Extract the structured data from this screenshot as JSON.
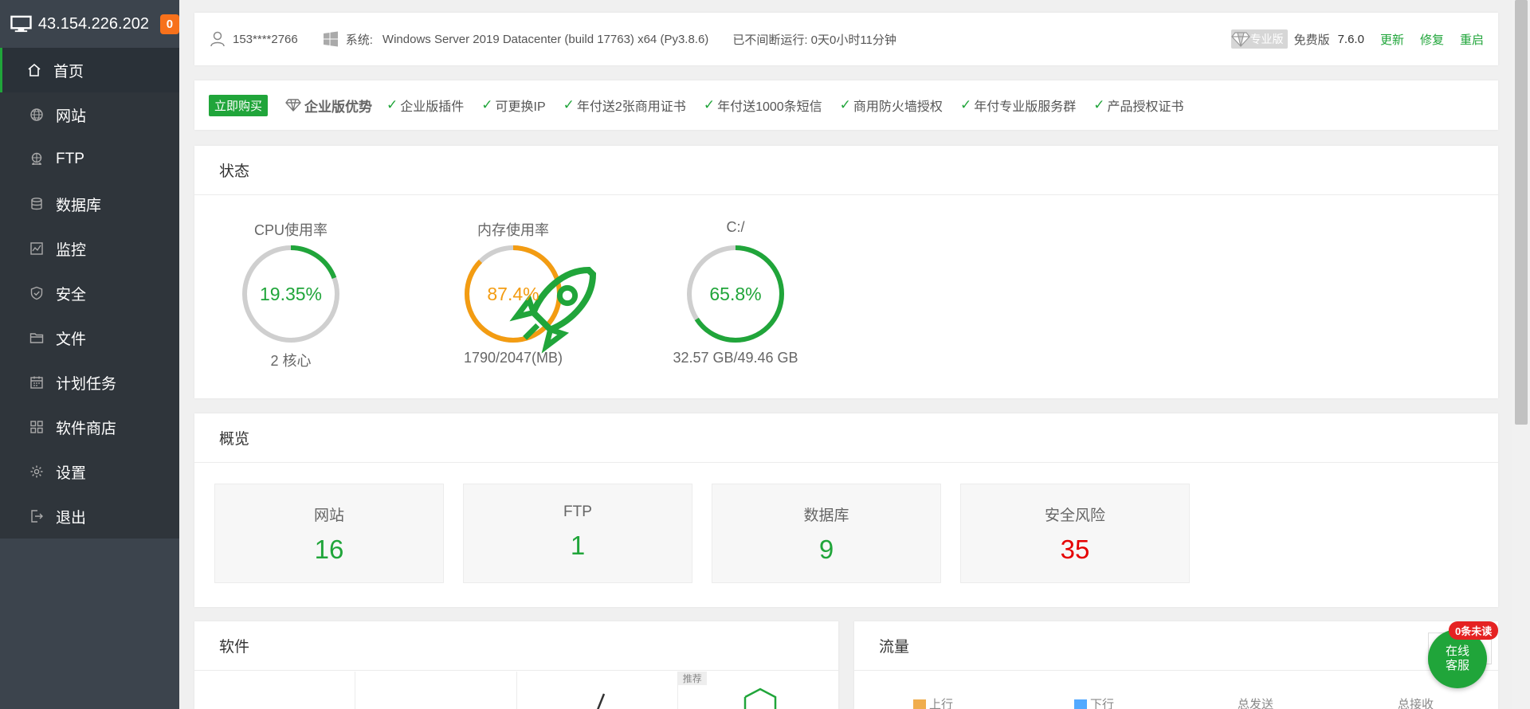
{
  "sidebar": {
    "server_ip": "43.154.226.202",
    "notification_count": "0",
    "items": [
      {
        "label": "首页",
        "icon": "home-icon"
      },
      {
        "label": "网站",
        "icon": "globe-icon"
      },
      {
        "label": "FTP",
        "icon": "ftp-icon"
      },
      {
        "label": "数据库",
        "icon": "database-icon"
      },
      {
        "label": "监控",
        "icon": "monitor-chart-icon"
      },
      {
        "label": "安全",
        "icon": "shield-icon"
      },
      {
        "label": "文件",
        "icon": "folder-icon"
      },
      {
        "label": "计划任务",
        "icon": "calendar-icon"
      },
      {
        "label": "软件商店",
        "icon": "grid-icon"
      },
      {
        "label": "设置",
        "icon": "gear-icon"
      },
      {
        "label": "退出",
        "icon": "logout-icon"
      }
    ],
    "active_index": 0
  },
  "topbar": {
    "user": "153****2766",
    "system_label": "系统:",
    "system_value": "Windows Server 2019 Datacenter (build 17763) x64 (Py3.8.6)",
    "uptime": "已不间断运行: 0天0小时11分钟",
    "pro_tag": "专业版",
    "edition": "免费版",
    "version": "7.6.0",
    "update": "更新",
    "repair": "修复",
    "restart": "重启"
  },
  "promo": {
    "buy_now": "立即购买",
    "title": "企业版优势",
    "features": [
      "企业版插件",
      "可更换IP",
      "年付送2张商用证书",
      "年付送1000条短信",
      "商用防火墙授权",
      "年付专业版服务群",
      "产品授权证书"
    ]
  },
  "status": {
    "title": "状态",
    "gauges": [
      {
        "title": "CPU使用率",
        "value": "19.35%",
        "percent": 19.35,
        "sub": "2 核心",
        "color": "#20a53a"
      },
      {
        "title": "内存使用率",
        "value": "87.4%",
        "percent": 87.4,
        "sub": "1790/2047(MB)",
        "color": "#f39c12"
      },
      {
        "title": "C:/",
        "value": "65.8%",
        "percent": 65.8,
        "sub": "32.57 GB/49.46 GB",
        "color": "#20a53a"
      }
    ]
  },
  "overview": {
    "title": "概览",
    "boxes": [
      {
        "label": "网站",
        "value": "16"
      },
      {
        "label": "FTP",
        "value": "1"
      },
      {
        "label": "数据库",
        "value": "9"
      },
      {
        "label": "安全风险",
        "value": "35"
      }
    ]
  },
  "software": {
    "title": "软件",
    "recommend_tag": "推荐"
  },
  "traffic": {
    "title": "流量",
    "legend": [
      "上行",
      "下行"
    ],
    "totals": [
      "总发送",
      "总接收"
    ]
  },
  "chat": {
    "unread": "0条未读",
    "line1": "在线",
    "line2": "客服"
  },
  "colors": {
    "accent": "#20a53a",
    "warning": "#f39c12",
    "danger": "#e50000",
    "sidebar_bg": "#3c444d"
  }
}
